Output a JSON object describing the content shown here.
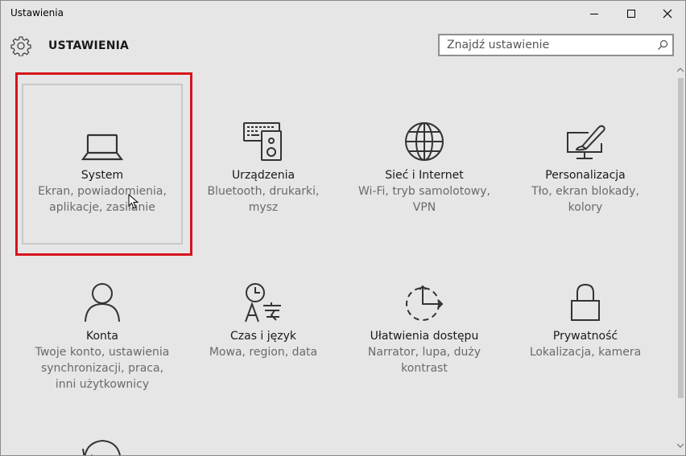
{
  "window": {
    "title": "Ustawienia"
  },
  "header": {
    "title": "USTAWIENIA",
    "search_placeholder": "Znajdź ustawienie"
  },
  "tiles": [
    {
      "name": "System",
      "desc": [
        "Ekran, powiadomienia,",
        "aplikacje, zasilanie"
      ],
      "icon": "laptop-icon"
    },
    {
      "name": "Urządzenia",
      "desc": [
        "Bluetooth, drukarki,",
        "mysz"
      ],
      "icon": "devices-icon"
    },
    {
      "name": "Sieć i Internet",
      "desc": [
        "Wi-Fi, tryb samolotowy,",
        "VPN"
      ],
      "icon": "globe-icon"
    },
    {
      "name": "Personalizacja",
      "desc": [
        "Tło, ekran blokady,",
        "kolory"
      ],
      "icon": "personalization-icon"
    },
    {
      "name": "Konta",
      "desc": [
        "Twoje konto, ustawienia",
        "synchronizacji, praca,",
        "inni użytkownicy"
      ],
      "icon": "person-icon"
    },
    {
      "name": "Czas i język",
      "desc": [
        "Mowa, region, data"
      ],
      "icon": "time-language-icon"
    },
    {
      "name": "Ułatwienia dostępu",
      "desc": [
        "Narrator, lupa, duży",
        "kontrast"
      ],
      "icon": "ease-of-access-icon"
    },
    {
      "name": "Prywatność",
      "desc": [
        "Lokalizacja, kamera"
      ],
      "icon": "lock-icon"
    }
  ],
  "colors": {
    "highlight": "#d4141c",
    "background": "#e6e6e6"
  }
}
